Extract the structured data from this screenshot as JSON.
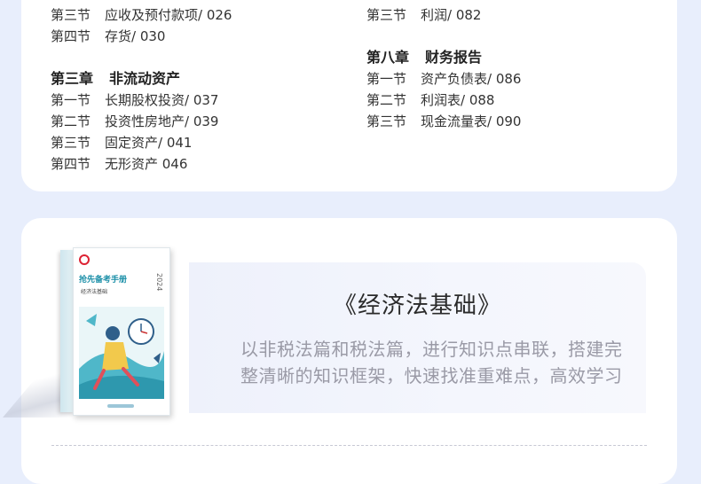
{
  "toc": {
    "left": [
      {
        "kind": "line",
        "sec": "第三节",
        "text": "应收及预付款项/  026"
      },
      {
        "kind": "line",
        "sec": "第四节",
        "text": "存货/  030"
      },
      {
        "kind": "gap"
      },
      {
        "kind": "chapter",
        "num": "第三章",
        "text": "非流动资产"
      },
      {
        "kind": "line",
        "sec": "第一节",
        "text": "长期股权投资/  037"
      },
      {
        "kind": "line",
        "sec": "第二节",
        "text": "投资性房地产/  039"
      },
      {
        "kind": "line",
        "sec": "第三节",
        "text": "固定资产/  041"
      },
      {
        "kind": "line",
        "sec": "第四节",
        "text": "无形资产  046"
      }
    ],
    "right": [
      {
        "kind": "line",
        "sec": "第三节",
        "text": "利润/  082"
      },
      {
        "kind": "gap"
      },
      {
        "kind": "chapter",
        "num": "第八章",
        "text": "财务报告"
      },
      {
        "kind": "line",
        "sec": "第一节",
        "text": "资产负债表/  086"
      },
      {
        "kind": "line",
        "sec": "第二节",
        "text": "利润表/  088"
      },
      {
        "kind": "line",
        "sec": "第三节",
        "text": "现金流量表/  090"
      }
    ]
  },
  "book": {
    "title": "《经济法基础》",
    "description_line1": "以非税法篇和税法篇，进行知识点串联，搭建完",
    "description_line2": "整清晰的知识框架，快速找准重难点，高效学习",
    "cover_title": "抢先备考手册",
    "cover_subtitle": "经济法基础",
    "cover_year": "2024"
  },
  "colors": {
    "page_background": "#e8eefc",
    "card_background": "#ffffff",
    "cover_accent": "#1b8fa8"
  }
}
